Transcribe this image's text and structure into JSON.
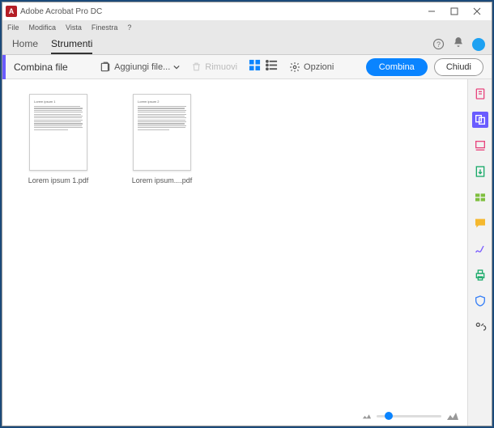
{
  "app": {
    "title": "Adobe Acrobat Pro DC"
  },
  "menubar": {
    "file": "File",
    "modifica": "Modifica",
    "vista": "Vista",
    "finestra": "Finestra",
    "help": "?"
  },
  "tabs": {
    "home": "Home",
    "strumenti": "Strumenti"
  },
  "toolbar": {
    "title": "Combina file",
    "add": "Aggiungi file...",
    "remove": "Rimuovi",
    "options": "Opzioni",
    "combine": "Combina",
    "close": "Chiudi"
  },
  "files": [
    {
      "header": "Lorem ipsum 1",
      "label": "Lorem ipsum 1.pdf"
    },
    {
      "header": "Lorem ipsum 2",
      "label": "Lorem ipsum....pdf"
    }
  ]
}
